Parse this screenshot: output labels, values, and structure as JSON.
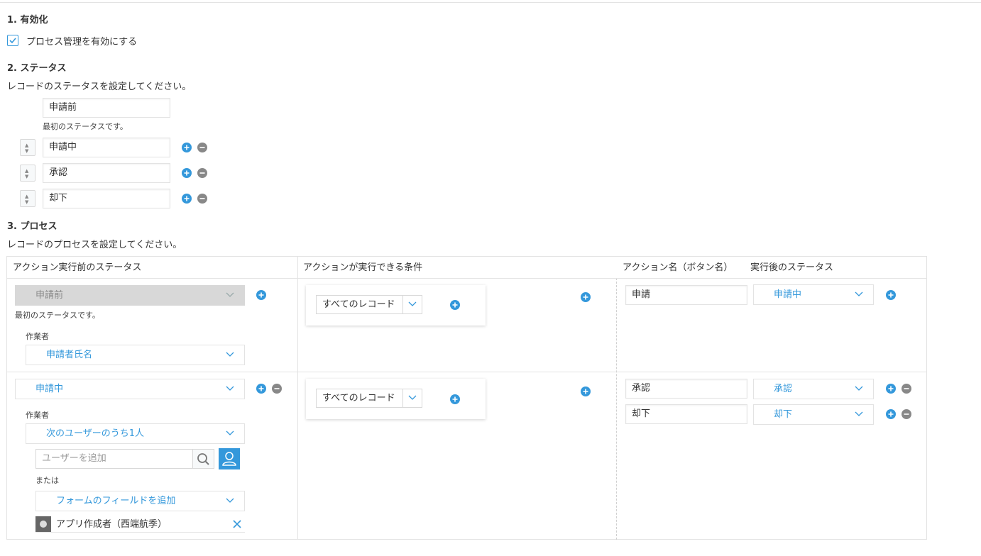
{
  "section1": {
    "heading": "1. 有効化",
    "checkbox_label": "プロセス管理を有効にする",
    "checked": true
  },
  "section2": {
    "heading": "2. ステータス",
    "description": "レコードのステータスを設定してください。",
    "first_status": "申請前",
    "first_status_note": "最初のステータスです。",
    "statuses": [
      "申請中",
      "承認",
      "却下"
    ]
  },
  "section3": {
    "heading": "3. プロセス",
    "description": "レコードのプロセスを設定してください。",
    "columns": {
      "before_status": "アクション実行前のステータス",
      "conditions": "アクションが実行できる条件",
      "action_name": "アクション名（ボタン名）",
      "after_status": "実行後のステータス"
    },
    "rows": [
      {
        "before_status": "申請前",
        "first_note": "最初のステータスです。",
        "assignee_label": "作業者",
        "assignee": "申請者氏名",
        "condition": "すべてのレコード",
        "actions": [
          {
            "name": "申請",
            "after": "申請中"
          }
        ]
      },
      {
        "before_status": "申請中",
        "assignee_label": "作業者",
        "assignee": "次のユーザーのうち1人",
        "user_placeholder": "ユーザーを追加",
        "or_label": "または",
        "field_select": "フォームのフィールドを追加",
        "chip_label": "アプリ作成者（西端航季）",
        "condition": "すべてのレコード",
        "actions": [
          {
            "name": "承認",
            "after": "承認"
          },
          {
            "name": "却下",
            "after": "却下"
          }
        ]
      }
    ]
  },
  "colors": {
    "accent": "#3498db",
    "muted": "#888888",
    "border": "#e3e3e3"
  }
}
